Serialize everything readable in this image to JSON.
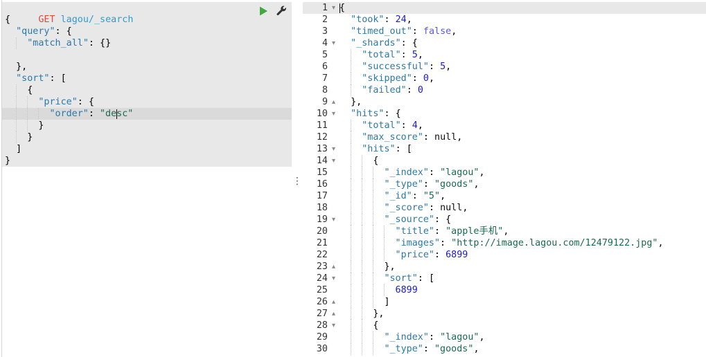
{
  "request_editor": {
    "method": "GET",
    "url": "lagou/_search",
    "body_lines": [
      "{",
      "  \"query\": {",
      "    \"match_all\": {}",
      "",
      "  },",
      "  \"sort\": [",
      "    {",
      "      \"price\": {",
      "        \"order\": \"desc\"",
      "      }",
      "    }",
      "  ]",
      "}"
    ]
  },
  "response_viewer": {
    "lines": [
      {
        "n": 1,
        "text": "{",
        "fold": "start"
      },
      {
        "n": 2,
        "text": "  \"took\": 24,"
      },
      {
        "n": 3,
        "text": "  \"timed_out\": false,"
      },
      {
        "n": 4,
        "text": "  \"_shards\": {",
        "fold": "start"
      },
      {
        "n": 5,
        "text": "    \"total\": 5,"
      },
      {
        "n": 6,
        "text": "    \"successful\": 5,"
      },
      {
        "n": 7,
        "text": "    \"skipped\": 0,"
      },
      {
        "n": 8,
        "text": "    \"failed\": 0"
      },
      {
        "n": 9,
        "text": "  },",
        "fold": "end"
      },
      {
        "n": 10,
        "text": "  \"hits\": {",
        "fold": "start"
      },
      {
        "n": 11,
        "text": "    \"total\": 4,"
      },
      {
        "n": 12,
        "text": "    \"max_score\": null,"
      },
      {
        "n": 13,
        "text": "    \"hits\": [",
        "fold": "start"
      },
      {
        "n": 14,
        "text": "      {",
        "fold": "start"
      },
      {
        "n": 15,
        "text": "        \"_index\": \"lagou\","
      },
      {
        "n": 16,
        "text": "        \"_type\": \"goods\","
      },
      {
        "n": 17,
        "text": "        \"_id\": \"5\","
      },
      {
        "n": 18,
        "text": "        \"_score\": null,"
      },
      {
        "n": 19,
        "text": "        \"_source\": {",
        "fold": "start"
      },
      {
        "n": 20,
        "text": "          \"title\": \"apple手机\","
      },
      {
        "n": 21,
        "text": "          \"images\": \"http://image.lagou.com/12479122.jpg\","
      },
      {
        "n": 22,
        "text": "          \"price\": 6899"
      },
      {
        "n": 23,
        "text": "        },",
        "fold": "end"
      },
      {
        "n": 24,
        "text": "        \"sort\": [",
        "fold": "start"
      },
      {
        "n": 25,
        "text": "          6899"
      },
      {
        "n": 26,
        "text": "        ]",
        "fold": "end"
      },
      {
        "n": 27,
        "text": "      },",
        "fold": "end"
      },
      {
        "n": 28,
        "text": "      {",
        "fold": "start"
      },
      {
        "n": 29,
        "text": "        \"_index\": \"lagou\","
      },
      {
        "n": 30,
        "text": "        \"_type\": \"goods\","
      }
    ]
  },
  "icons": {
    "run": "play-icon",
    "settings": "wrench-icon",
    "resize": "vertical-ellipsis-icon",
    "fold_start": "chevron-down-icon",
    "fold_end": "chevron-up-icon"
  },
  "colors": {
    "method": "#e2483d",
    "url": "#2a9fd6",
    "key": "#2b79a8",
    "string": "#186a4f",
    "number": "#1a1ac8",
    "boolean": "#5b5bd4",
    "null": "#111111",
    "punctuation": "#000000",
    "text": "#000000",
    "run_button": "#41a941",
    "settings_icon": "#333333",
    "request_block_bg": "#e8e8e8",
    "active_line_bg": "#dadada",
    "response_active_line_bg": "#e8e8e8"
  }
}
